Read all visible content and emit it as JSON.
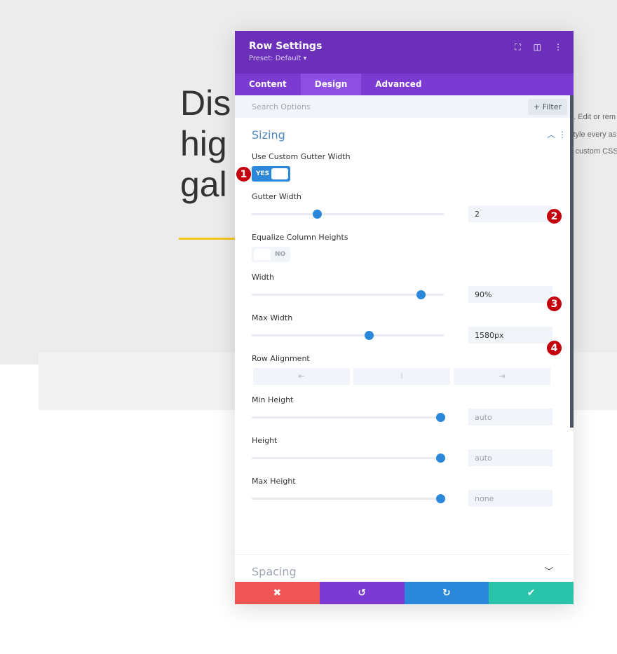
{
  "page": {
    "heading": "Dis\nhig\ngal",
    "side_text": [
      "e. Edit or rem",
      "style every as",
      "y custom CSS"
    ]
  },
  "panel": {
    "title": "Row Settings",
    "preset": "Preset: Default ▾",
    "tabs": [
      {
        "label": "Content"
      },
      {
        "label": "Design",
        "active": true
      },
      {
        "label": "Advanced"
      }
    ],
    "search_placeholder": "Search Options",
    "filter_label": "+ Filter",
    "section": "Sizing",
    "custom_gutter": {
      "label": "Use Custom Gutter Width",
      "value": "YES"
    },
    "gutter_width": {
      "label": "Gutter Width",
      "value": "2",
      "slider": 0.34
    },
    "equalize": {
      "label": "Equalize Column Heights",
      "value": "NO"
    },
    "width": {
      "label": "Width",
      "value": "90%",
      "slider": 0.88
    },
    "max_width": {
      "label": "Max Width",
      "value": "1580px",
      "slider": 0.61
    },
    "row_alignment": {
      "label": "Row Alignment",
      "options": [
        "⇤",
        "⁞",
        "⇥"
      ]
    },
    "min_height": {
      "label": "Min Height",
      "value": "auto",
      "slider": 0.98
    },
    "height": {
      "label": "Height",
      "value": "auto",
      "slider": 0.98
    },
    "max_height": {
      "label": "Max Height",
      "value": "none",
      "slider": 0.98
    },
    "spacing_section": "Spacing",
    "footer": {
      "cancel": "✖",
      "undo": "↺",
      "redo": "↻",
      "save": "✔"
    },
    "colors": {
      "header": "#6b2fba",
      "accent": "#2b87da",
      "cancel": "#ef5555",
      "undo": "#7b3bd2",
      "redo": "#2b87da",
      "save": "#29c4a9"
    }
  },
  "badges": [
    "1",
    "2",
    "3",
    "4"
  ]
}
